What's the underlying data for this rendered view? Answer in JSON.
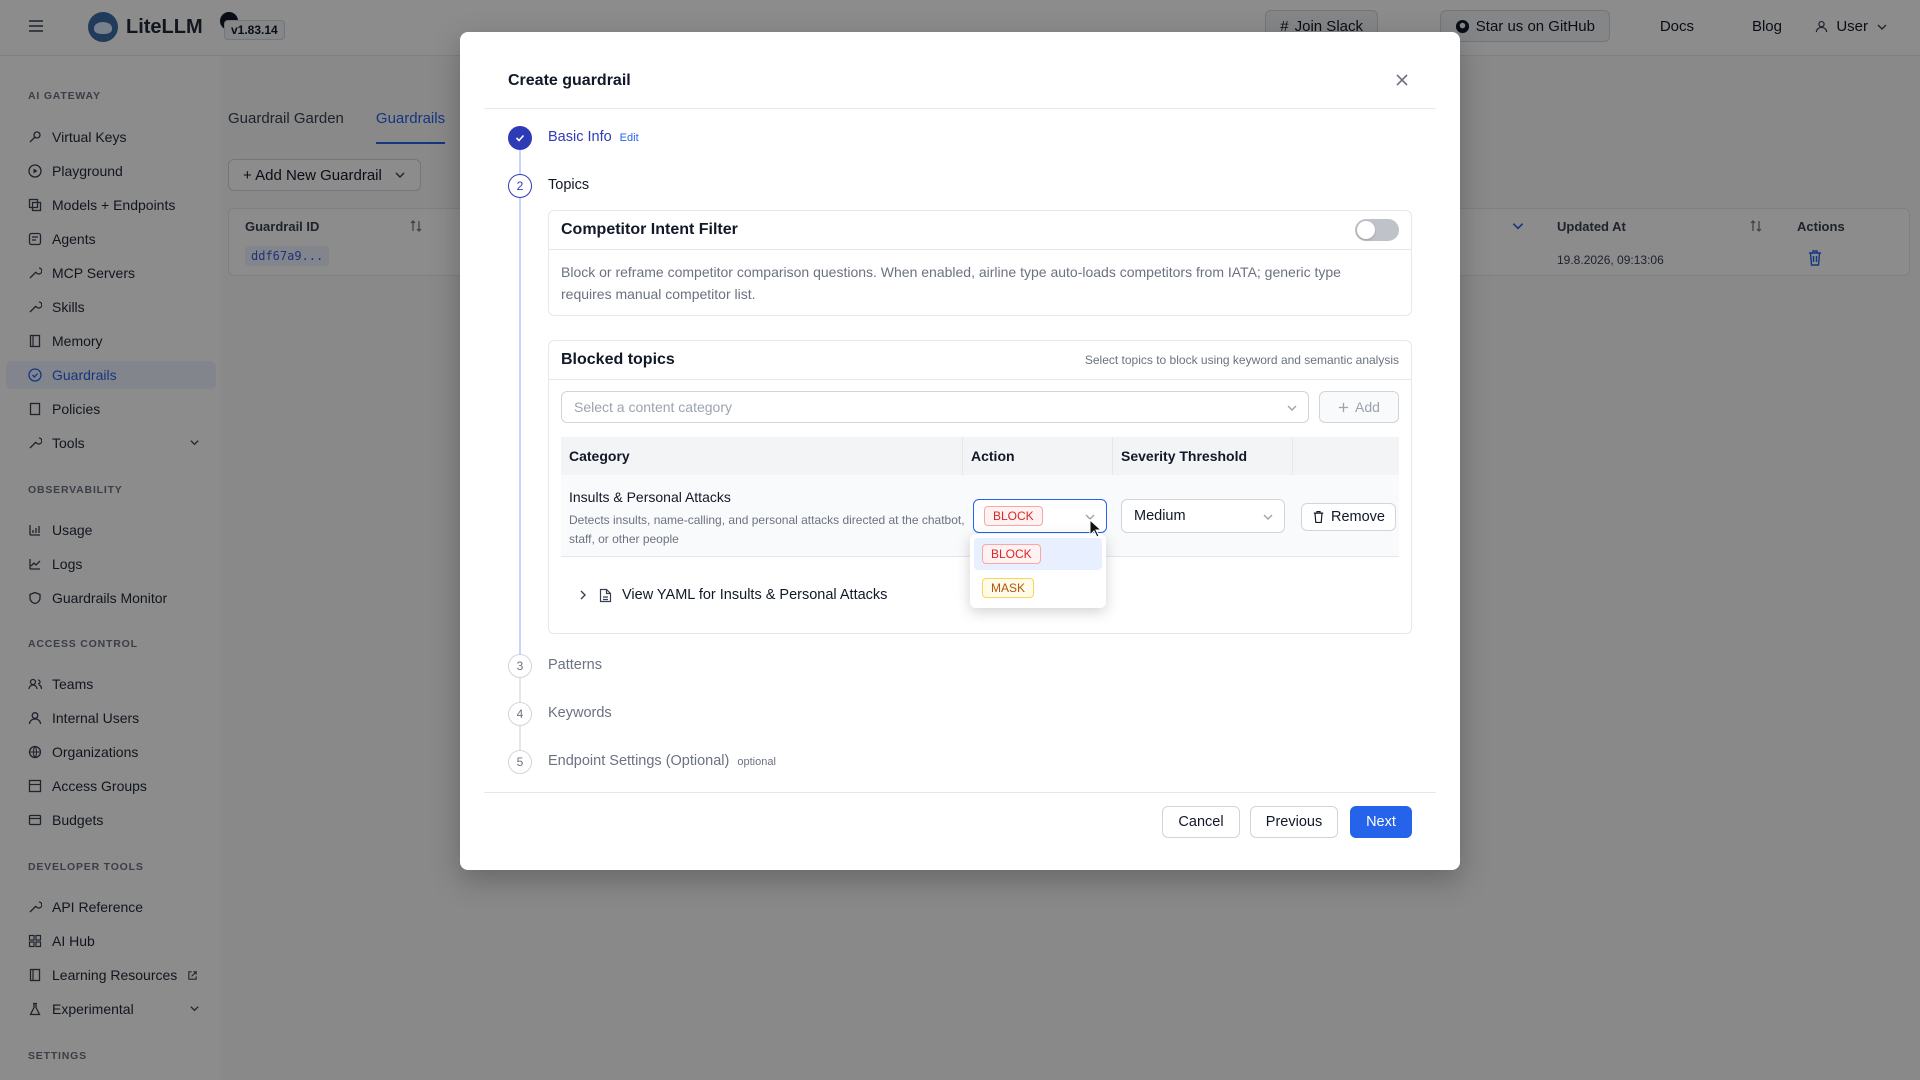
{
  "app": {
    "name": "LiteLLM",
    "version": "v1.83.14"
  },
  "topbar": {
    "join_slack": "Join Slack",
    "github": "Star us on GitHub",
    "docs": "Docs",
    "blog": "Blog",
    "user": "User"
  },
  "sidebar": {
    "sections": {
      "ai_gateway": "AI GATEWAY",
      "observability": "OBSERVABILITY",
      "access_control": "ACCESS CONTROL",
      "developer_tools": "DEVELOPER TOOLS",
      "settings": "SETTINGS"
    },
    "ai_gateway": [
      "Virtual Keys",
      "Playground",
      "Models + Endpoints",
      "Agents",
      "MCP Servers",
      "Skills",
      "Memory",
      "Guardrails",
      "Policies",
      "Tools"
    ],
    "observability": [
      "Usage",
      "Logs",
      "Guardrails Monitor"
    ],
    "access_control": [
      "Teams",
      "Internal Users",
      "Organizations",
      "Access Groups",
      "Budgets"
    ],
    "developer_tools": [
      "API Reference",
      "AI Hub",
      "Learning Resources",
      "Experimental"
    ],
    "active_item": "Guardrails"
  },
  "main": {
    "tabs": [
      "Guardrail Garden",
      "Guardrails"
    ],
    "active_tab": "Guardrails",
    "add_button": "+ Add New Guardrail",
    "table": {
      "headers": {
        "id": "Guardrail ID",
        "updated": "Updated At",
        "actions": "Actions"
      },
      "row": {
        "id": "ddf67a9...",
        "updated": "19.8.2026, 09:13:06"
      }
    }
  },
  "modal": {
    "title": "Create guardrail",
    "steps": [
      {
        "num": "1",
        "label": "Basic Info",
        "sub": "Edit",
        "state": "done"
      },
      {
        "num": "2",
        "label": "Topics",
        "sub": "",
        "state": "active"
      },
      {
        "num": "3",
        "label": "Patterns",
        "sub": "",
        "state": "pending"
      },
      {
        "num": "4",
        "label": "Keywords",
        "sub": "",
        "state": "pending"
      },
      {
        "num": "5",
        "label": "Endpoint Settings (Optional)",
        "sub": "optional",
        "state": "pending"
      }
    ],
    "competitor": {
      "title": "Competitor Intent Filter",
      "enabled": false,
      "description": "Block or reframe competitor comparison questions. When enabled, airline type auto-loads competitors from IATA; generic type requires manual competitor list."
    },
    "blocked": {
      "title": "Blocked topics",
      "hint": "Select topics to block using keyword and semantic analysis",
      "select_placeholder": "Select a content category",
      "add_label": "Add",
      "columns": [
        "Category",
        "Action",
        "Severity Threshold"
      ],
      "row": {
        "category": "Insults & Personal Attacks",
        "description": "Detects insults, name-calling, and personal attacks directed at the chatbot, staff, or other people",
        "action": "BLOCK",
        "severity": "Medium",
        "remove_label": "Remove"
      },
      "yaml_label": "View YAML for Insults & Personal Attacks",
      "action_options": [
        "BLOCK",
        "MASK"
      ]
    },
    "footer": {
      "cancel": "Cancel",
      "previous": "Previous",
      "next": "Next"
    }
  },
  "colors": {
    "primary": "#2563eb",
    "step": "#2e3bb7",
    "block": "#dc2626",
    "mask": "#b45309"
  }
}
